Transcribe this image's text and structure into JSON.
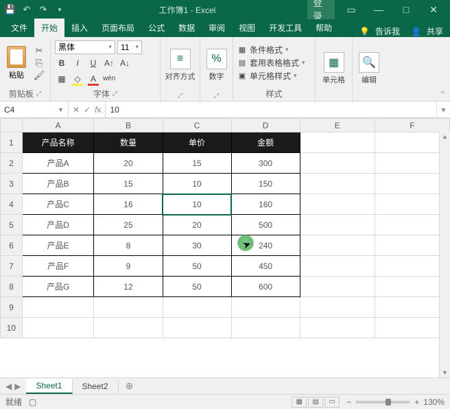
{
  "title": "工作簿1 - Excel",
  "login": "登录",
  "tabs": [
    "文件",
    "开始",
    "插入",
    "页面布局",
    "公式",
    "数据",
    "审阅",
    "视图",
    "开发工具",
    "帮助"
  ],
  "tell_me": "告诉我",
  "share": "共享",
  "ribbon": {
    "paste": "粘贴",
    "clipboard": "剪贴板",
    "font_name": "黑体",
    "font_size": "11",
    "font_group": "字体",
    "align": "对齐方式",
    "number": "数字",
    "cond_format": "条件格式",
    "table_format": "套用表格格式",
    "cell_styles": "单元格样式",
    "styles": "样式",
    "cells": "单元格",
    "editing": "编辑"
  },
  "namebox": "C4",
  "formula_value": "10",
  "columns": [
    "A",
    "B",
    "C",
    "D",
    "E",
    "F"
  ],
  "rows": [
    "1",
    "2",
    "3",
    "4",
    "5",
    "6",
    "7",
    "8",
    "9",
    "10"
  ],
  "table": {
    "headers": [
      "产品名称",
      "数量",
      "单价",
      "金额"
    ],
    "data": [
      [
        "产品A",
        "20",
        "15",
        "300"
      ],
      [
        "产品B",
        "15",
        "10",
        "150"
      ],
      [
        "产品C",
        "16",
        "10",
        "160"
      ],
      [
        "产品D",
        "25",
        "20",
        "500"
      ],
      [
        "产品E",
        "8",
        "30",
        "240"
      ],
      [
        "产品F",
        "9",
        "50",
        "450"
      ],
      [
        "产品G",
        "12",
        "50",
        "600"
      ]
    ]
  },
  "sheets": [
    "Sheet1",
    "Sheet2"
  ],
  "status_ready": "就绪",
  "status_rec": "",
  "zoom": "130%",
  "chart_data": {
    "type": "table",
    "title": "",
    "columns": [
      "产品名称",
      "数量",
      "单价",
      "金额"
    ],
    "rows": [
      {
        "产品名称": "产品A",
        "数量": 20,
        "单价": 15,
        "金额": 300
      },
      {
        "产品名称": "产品B",
        "数量": 15,
        "单价": 10,
        "金额": 150
      },
      {
        "产品名称": "产品C",
        "数量": 16,
        "单价": 10,
        "金额": 160
      },
      {
        "产品名称": "产品D",
        "数量": 25,
        "单价": 20,
        "金额": 500
      },
      {
        "产品名称": "产品E",
        "数量": 8,
        "单价": 30,
        "金额": 240
      },
      {
        "产品名称": "产品F",
        "数量": 9,
        "单价": 50,
        "金额": 450
      },
      {
        "产品名称": "产品G",
        "数量": 12,
        "单价": 50,
        "金额": 600
      }
    ]
  }
}
